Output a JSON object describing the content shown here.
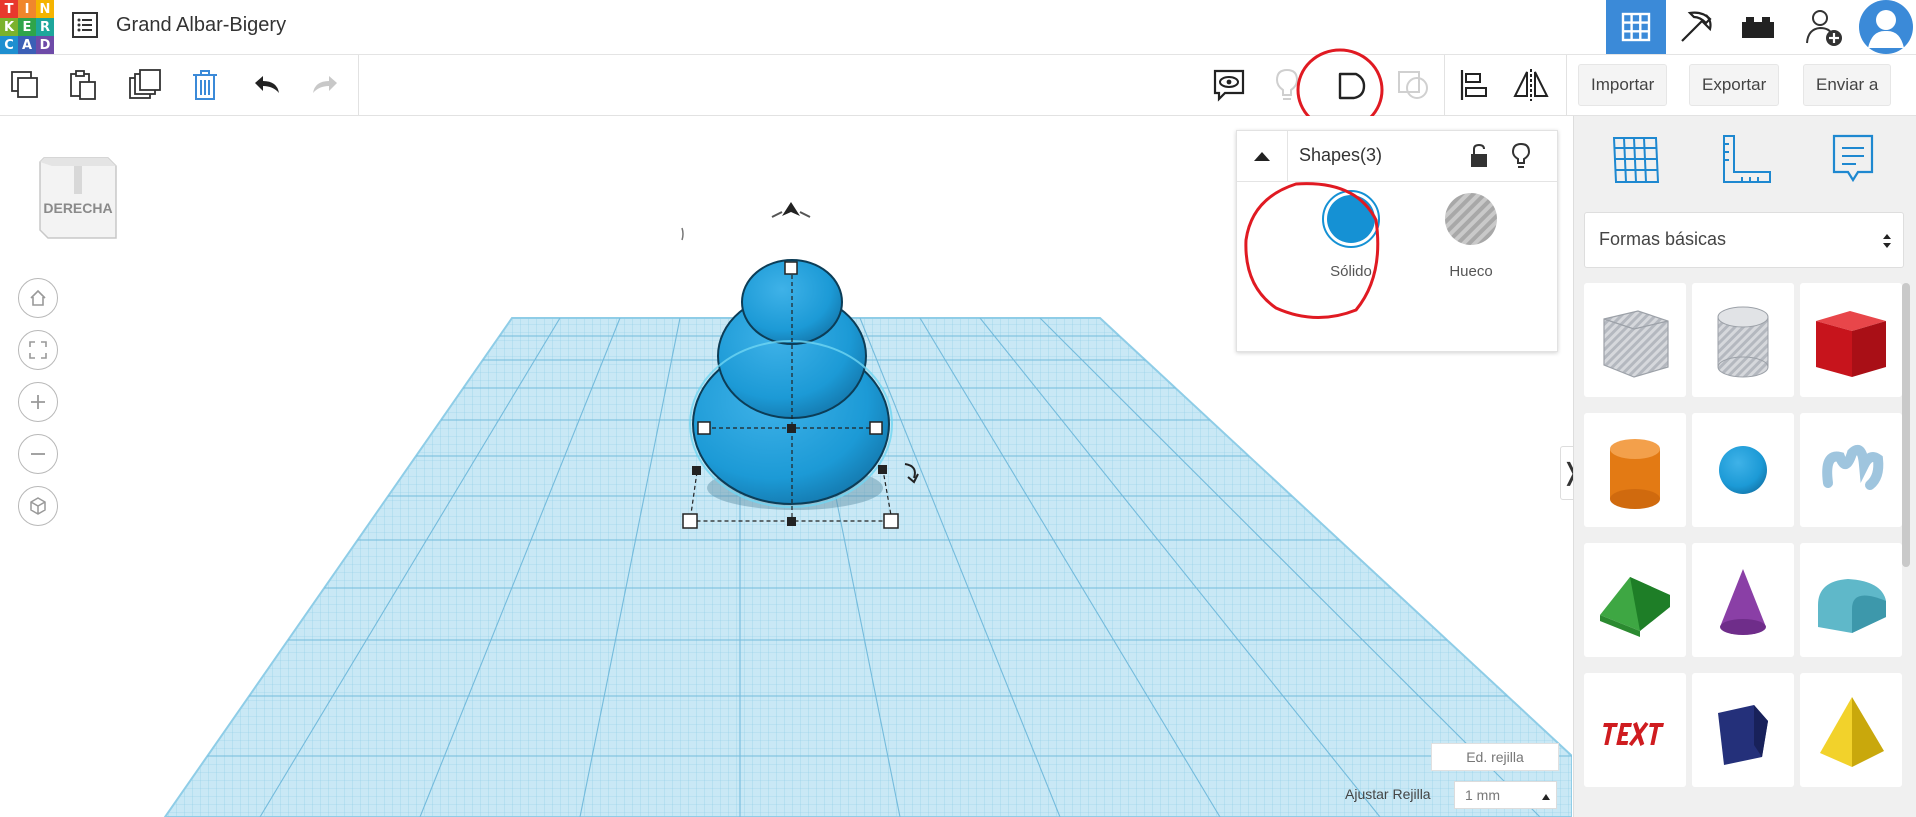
{
  "app": {
    "logo_letters": [
      "T",
      "I",
      "N",
      "K",
      "E",
      "R",
      "C",
      "A",
      "D"
    ],
    "logo_colors": [
      "#e8382d",
      "#f0862c",
      "#f5b400",
      "#7bb22c",
      "#2fa54a",
      "#1da69b",
      "#1e8fd0",
      "#3b5fb6",
      "#6e4ba8"
    ],
    "project_title": "Grand Albar-Bigery"
  },
  "toolbar": {
    "import_label": "Importar",
    "export_label": "Exportar",
    "send_label": "Enviar a"
  },
  "viewcube": {
    "face_label": "DERECHA"
  },
  "shape_panel": {
    "title": "Shapes(3)",
    "solid_label": "Sólido",
    "hole_label": "Hueco",
    "solid_color": "#1591d4"
  },
  "sidebar": {
    "category_selected": "Formas básicas",
    "shapes": [
      "box-hole-icon",
      "cylinder-hole-icon",
      "box-icon",
      "cylinder-icon",
      "sphere-icon",
      "scribble-icon",
      "roof-icon",
      "cone-icon",
      "round-roof-icon",
      "text-icon",
      "polygon-icon",
      "pyramid-icon"
    ]
  },
  "grid": {
    "edit_label": "Ed. rejilla",
    "snap_label": "Ajustar Rejilla",
    "snap_value": "1 mm"
  },
  "colors": {
    "accent": "#3b8ad8",
    "workplane": "#bfe3f2",
    "annotation": "#e01a22",
    "object": "#1c9ad6"
  }
}
